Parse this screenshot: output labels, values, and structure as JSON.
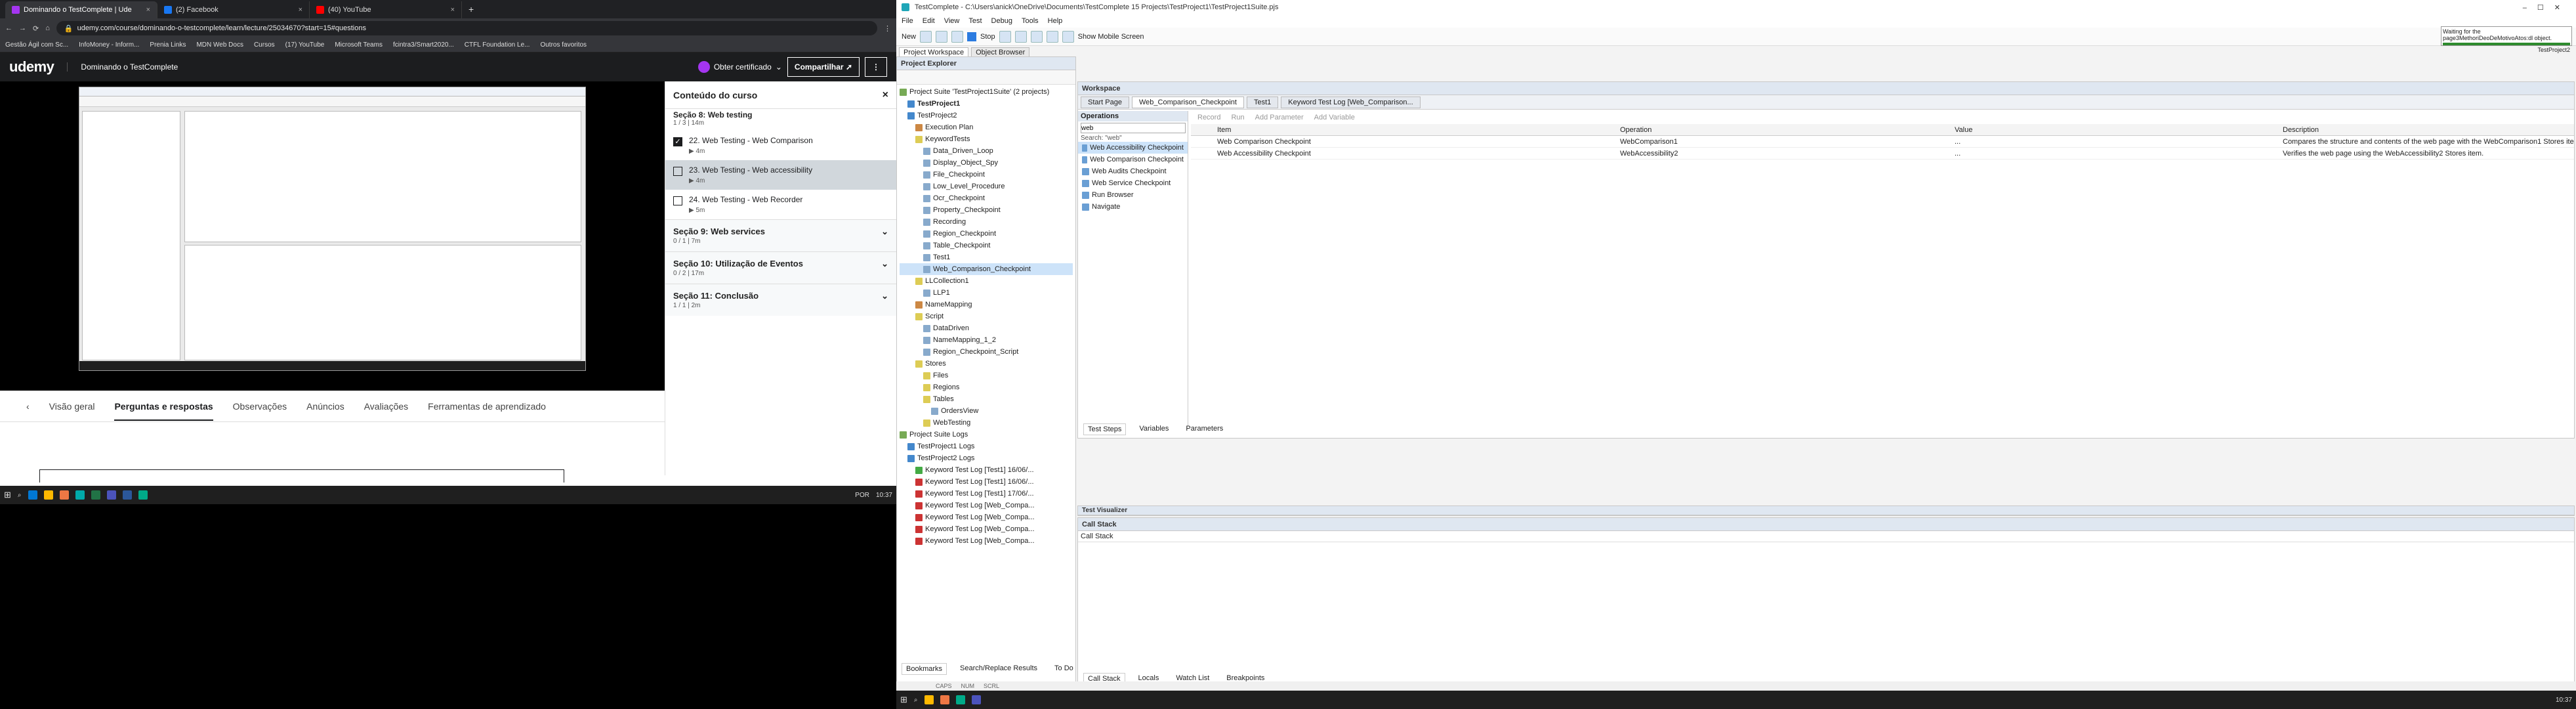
{
  "left": {
    "chrome_tabs": [
      {
        "title": "Dominando o TestComplete | Ude",
        "active": true
      },
      {
        "title": "(2) Facebook",
        "active": false
      },
      {
        "title": "(40) YouTube",
        "active": false
      }
    ],
    "url": "udemy.com/course/dominando-o-testcomplete/learn/lecture/25034670?start=15#questions",
    "bookmarks": [
      "Gestão Ágil com Sc...",
      "InfoMoney - Inform...",
      "Prenia Links",
      "MDN Web Docs",
      "Cursos",
      "(17) YouTube",
      "Microsoft Teams",
      "fcintra3/Smart2020...",
      "CTFL Foundation Le...",
      "Outros favoritos"
    ],
    "udemy": {
      "logo": "udemy",
      "course_title": "Dominando o TestComplete",
      "cert_label": "Obter certificado",
      "share_label": "Compartilhar"
    },
    "tabs": [
      "Visão geral",
      "Perguntas e respostas",
      "Observações",
      "Anúncios",
      "Avaliações",
      "Ferramentas de aprendizado"
    ],
    "active_tab": "Perguntas e respostas",
    "sidebar": {
      "title": "Conteúdo do curso",
      "partial_section": {
        "title": "Seção 8: Web testing",
        "meta": "1 / 3 | 14m"
      },
      "lectures": [
        {
          "title": "22. Web Testing - Web Comparison",
          "dur": "4m",
          "checked": true,
          "selected": false
        },
        {
          "title": "23. Web Testing - Web accessibility",
          "dur": "4m",
          "checked": false,
          "selected": true
        },
        {
          "title": "24. Web Testing - Web Recorder",
          "dur": "5m",
          "checked": false,
          "selected": false
        }
      ],
      "sections": [
        {
          "title": "Seção 9: Web services",
          "meta": "0 / 1 | 7m"
        },
        {
          "title": "Seção 10: Utilização de Eventos",
          "meta": "0 / 2 | 17m"
        },
        {
          "title": "Seção 11: Conclusão",
          "meta": "1 / 1 | 2m"
        }
      ]
    },
    "taskbar": {
      "search": "",
      "lang": "POR",
      "time": "10:37"
    }
  },
  "right": {
    "title": "TestComplete - C:\\Users\\anick\\OneDrive\\Documents\\TestComplete 15 Projects\\TestProject1\\TestProject1Suite.pjs",
    "menu": [
      "File",
      "Edit",
      "View",
      "Test",
      "Debug",
      "Tools",
      "Help"
    ],
    "toolbar": {
      "new_label": "New",
      "stop_label": "Stop",
      "mobile_label": "Show Mobile Screen"
    },
    "notice": {
      "text": "Waiting for the page3MethoriDeoDeMotivoAtos:dl object.",
      "project": "TestProject2"
    },
    "ws_tabs": [
      "Project Workspace",
      "Object Browser"
    ],
    "explorer": {
      "title": "Project Explorer",
      "nodes": [
        {
          "t": "Project Suite 'TestProject1Suite' (2 projects)",
          "d": 0,
          "c": "#7a5"
        },
        {
          "t": "TestProject1",
          "d": 1,
          "c": "#48c",
          "b": true
        },
        {
          "t": "TestProject2",
          "d": 1,
          "c": "#48c"
        },
        {
          "t": "Execution Plan",
          "d": 2,
          "c": "#c84"
        },
        {
          "t": "KeywordTests",
          "d": 2,
          "c": "#dc5"
        },
        {
          "t": "Data_Driven_Loop",
          "d": 3,
          "c": "#8ac"
        },
        {
          "t": "Display_Object_Spy",
          "d": 3,
          "c": "#8ac"
        },
        {
          "t": "File_Checkpoint",
          "d": 3,
          "c": "#8ac"
        },
        {
          "t": "Low_Level_Procedure",
          "d": 3,
          "c": "#8ac"
        },
        {
          "t": "Ocr_Checkpoint",
          "d": 3,
          "c": "#8ac"
        },
        {
          "t": "Property_Checkpoint",
          "d": 3,
          "c": "#8ac"
        },
        {
          "t": "Recording",
          "d": 3,
          "c": "#8ac"
        },
        {
          "t": "Region_Checkpoint",
          "d": 3,
          "c": "#8ac"
        },
        {
          "t": "Table_Checkpoint",
          "d": 3,
          "c": "#8ac"
        },
        {
          "t": "Test1",
          "d": 3,
          "c": "#8ac"
        },
        {
          "t": "Web_Comparison_Checkpoint",
          "d": 3,
          "c": "#8ac",
          "sel": true
        },
        {
          "t": "LLCollection1",
          "d": 2,
          "c": "#dc5"
        },
        {
          "t": "LLP1",
          "d": 3,
          "c": "#8ac"
        },
        {
          "t": "NameMapping",
          "d": 2,
          "c": "#c84"
        },
        {
          "t": "Script",
          "d": 2,
          "c": "#dc5"
        },
        {
          "t": "DataDriven",
          "d": 3,
          "c": "#8ac"
        },
        {
          "t": "NameMapping_1_2",
          "d": 3,
          "c": "#8ac"
        },
        {
          "t": "Region_Checkpoint_Script",
          "d": 3,
          "c": "#8ac"
        },
        {
          "t": "Stores",
          "d": 2,
          "c": "#dc5"
        },
        {
          "t": "Files",
          "d": 3,
          "c": "#dc5"
        },
        {
          "t": "Regions",
          "d": 3,
          "c": "#dc5"
        },
        {
          "t": "Tables",
          "d": 3,
          "c": "#dc5"
        },
        {
          "t": "OrdersView",
          "d": 4,
          "c": "#8ac"
        },
        {
          "t": "WebTesting",
          "d": 3,
          "c": "#dc5"
        },
        {
          "t": "Project Suite Logs",
          "d": 0,
          "c": "#7a5"
        },
        {
          "t": "TestProject1 Logs",
          "d": 1,
          "c": "#48c"
        },
        {
          "t": "TestProject2 Logs",
          "d": 1,
          "c": "#48c"
        },
        {
          "t": "Keyword Test Log [Test1] 16/06/...",
          "d": 2,
          "c": "#4a4"
        },
        {
          "t": "Keyword Test Log [Test1] 16/06/...",
          "d": 2,
          "c": "#c33"
        },
        {
          "t": "Keyword Test Log [Test1] 17/06/...",
          "d": 2,
          "c": "#c33"
        },
        {
          "t": "Keyword Test Log [Web_Compa...",
          "d": 2,
          "c": "#c33"
        },
        {
          "t": "Keyword Test Log [Web_Compa...",
          "d": 2,
          "c": "#c33"
        },
        {
          "t": "Keyword Test Log [Web_Compa...",
          "d": 2,
          "c": "#c33"
        },
        {
          "t": "Keyword Test Log [Web_Compa...",
          "d": 2,
          "c": "#c33"
        }
      ]
    },
    "workspace": {
      "title": "Workspace",
      "tabs": [
        "Start Page",
        "Web_Comparison_Checkpoint",
        "Test1",
        "Keyword Test Log [Web_Comparison..."
      ],
      "operations_title": "Operations",
      "search_value": "web",
      "search_hint": "Search: \"web\"",
      "operations": [
        "Web Accessibility Checkpoint",
        "Web Comparison Checkpoint",
        "Web Audits Checkpoint",
        "Web Service Checkpoint",
        "Run Browser",
        "Navigate"
      ],
      "op_toolbar": [
        "Record",
        "Run",
        "Add Parameter",
        "Add Variable"
      ],
      "grid_headers": [
        "Item",
        "Operation",
        "Value",
        "Description"
      ],
      "grid_rows": [
        {
          "item": "Web Comparison Checkpoint",
          "op": "WebComparison1",
          "val": "...",
          "desc": "Compares the structure and contents of the web page with the WebComparison1 Stores item."
        },
        {
          "item": "Web Accessibility Checkpoint",
          "op": "WebAccessibility2",
          "val": "...",
          "desc": "Verifies the web page using the WebAccessibility2 Stores item."
        }
      ],
      "bottom_tabs": [
        "Test Steps",
        "Variables",
        "Parameters"
      ]
    },
    "test_visualizer": "Test Visualizer",
    "call_stack": {
      "title": "Call Stack",
      "header": "Call Stack"
    },
    "debug_tabs": [
      "Call Stack",
      "Locals",
      "Watch List",
      "Breakpoints"
    ],
    "footer_tabs": [
      "Bookmarks",
      "Search/Replace Results",
      "To Do"
    ],
    "status": [
      "CAPS",
      "NUM",
      "SCRL"
    ],
    "taskbar": {
      "time": "10:37"
    }
  }
}
